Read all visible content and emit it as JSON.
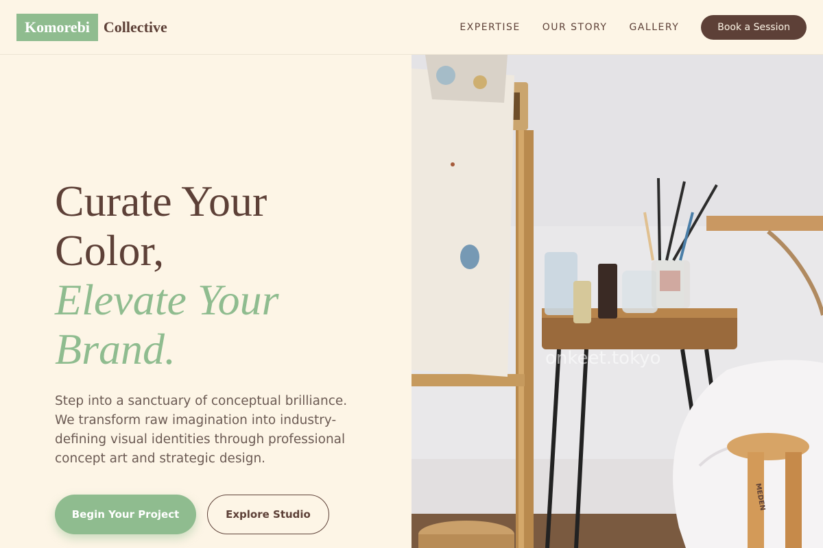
{
  "brand": {
    "box_text": "Komorebi",
    "word": "Collective"
  },
  "nav": {
    "links": [
      "EXPERTISE",
      "OUR STORY",
      "GALLERY"
    ],
    "cta": "Book a Session"
  },
  "hero": {
    "line1": "Curate Your",
    "line2": "Color,",
    "line3": "Elevate Your",
    "line4": "Brand.",
    "subtitle": "Step into a sanctuary of conceptual brilliance. We transform raw imagination into industry-defining visual identities through professional concept art and strategic design.",
    "primary_button": "Begin Your Project",
    "secondary_button": "Explore Studio"
  },
  "photo": {
    "watermark": "onkeet.tokyo",
    "stool_stamp": "MEDEN"
  },
  "colors": {
    "background": "#fdf5e6",
    "brown": "#5d4037",
    "sage": "#8fbc8f"
  }
}
